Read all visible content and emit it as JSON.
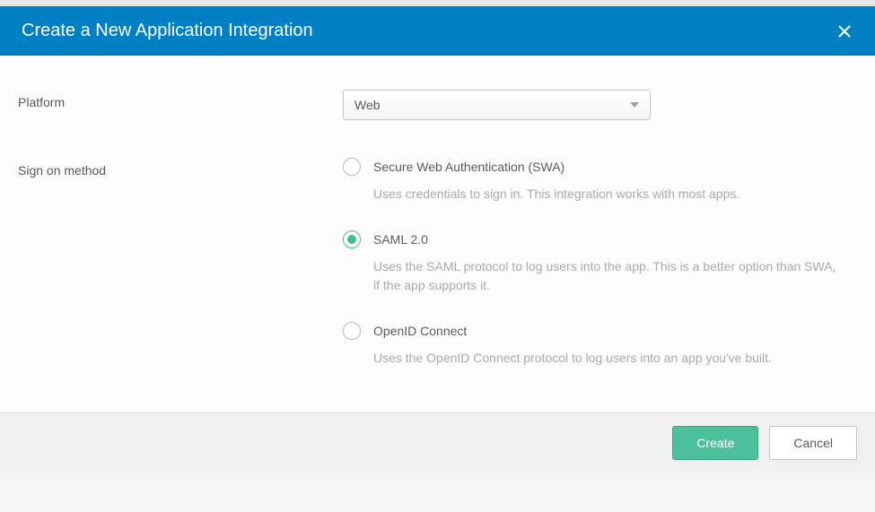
{
  "header": {
    "title": "Create a New Application Integration"
  },
  "form": {
    "platform_label": "Platform",
    "platform_value": "Web",
    "signon_label": "Sign on method",
    "options": [
      {
        "label": "Secure Web Authentication (SWA)",
        "description": "Uses credentials to sign in. This integration works with most apps.",
        "selected": false
      },
      {
        "label": "SAML 2.0",
        "description": "Uses the SAML protocol to log users into the app. This is a better option than SWA, if the app supports it.",
        "selected": true
      },
      {
        "label": "OpenID Connect",
        "description": "Uses the OpenID Connect protocol to log users into an app you've built.",
        "selected": false
      }
    ]
  },
  "footer": {
    "create_label": "Create",
    "cancel_label": "Cancel"
  }
}
